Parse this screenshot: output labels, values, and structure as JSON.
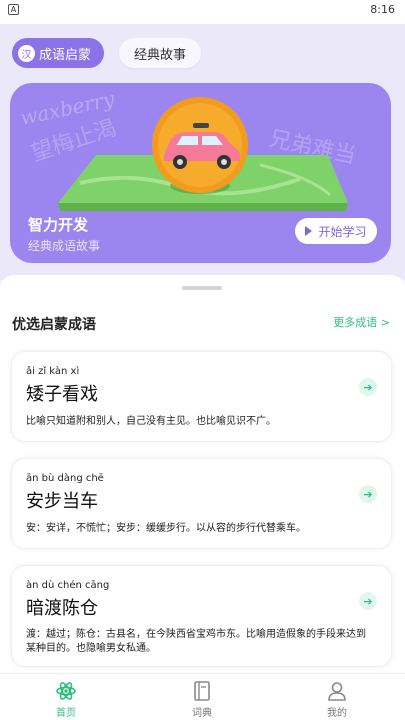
{
  "status_bar": {
    "left_icon": "A",
    "time": "8:16"
  },
  "top_tabs": [
    {
      "badge": "汉",
      "label": "成语启蒙",
      "active": true
    },
    {
      "label": "经典故事",
      "active": false
    }
  ],
  "banner": {
    "title": "智力开发",
    "subtitle": "经典成语故事",
    "button_label": "开始学习",
    "decor_text_left": "望梅止渴",
    "decor_text_right": "兄弟难当",
    "decor_latin": "waxberry"
  },
  "section": {
    "title": "优选启蒙成语",
    "more_label": "更多成语 >"
  },
  "idioms": [
    {
      "pinyin": "ǎi zǐ kàn xì",
      "word": "矮子看戏",
      "desc": "比喻只知道附和别人，自己没有主见。也比喻见识不广。"
    },
    {
      "pinyin": "ān bù dàng chē",
      "word": "安步当车",
      "desc": "安：安详，不慌忙；安步：缓缓步行。以从容的步行代替乘车。"
    },
    {
      "pinyin": "àn dù chén cāng",
      "word": "暗渡陈仓",
      "desc": "渡：越过；陈仓：古县名，在今陕西省宝鸡市东。比喻用造假象的手段来达到某种目的。也隐喻男女私通。"
    }
  ],
  "bottom_tabs": [
    {
      "label": "首页",
      "icon": "atom-icon",
      "active": true
    },
    {
      "label": "词典",
      "icon": "book-icon",
      "active": false
    },
    {
      "label": "我的",
      "icon": "user-icon",
      "active": false
    }
  ],
  "colors": {
    "accent": "#8a73e6",
    "green": "#2fbf7a",
    "banner": "#9b86ef"
  }
}
